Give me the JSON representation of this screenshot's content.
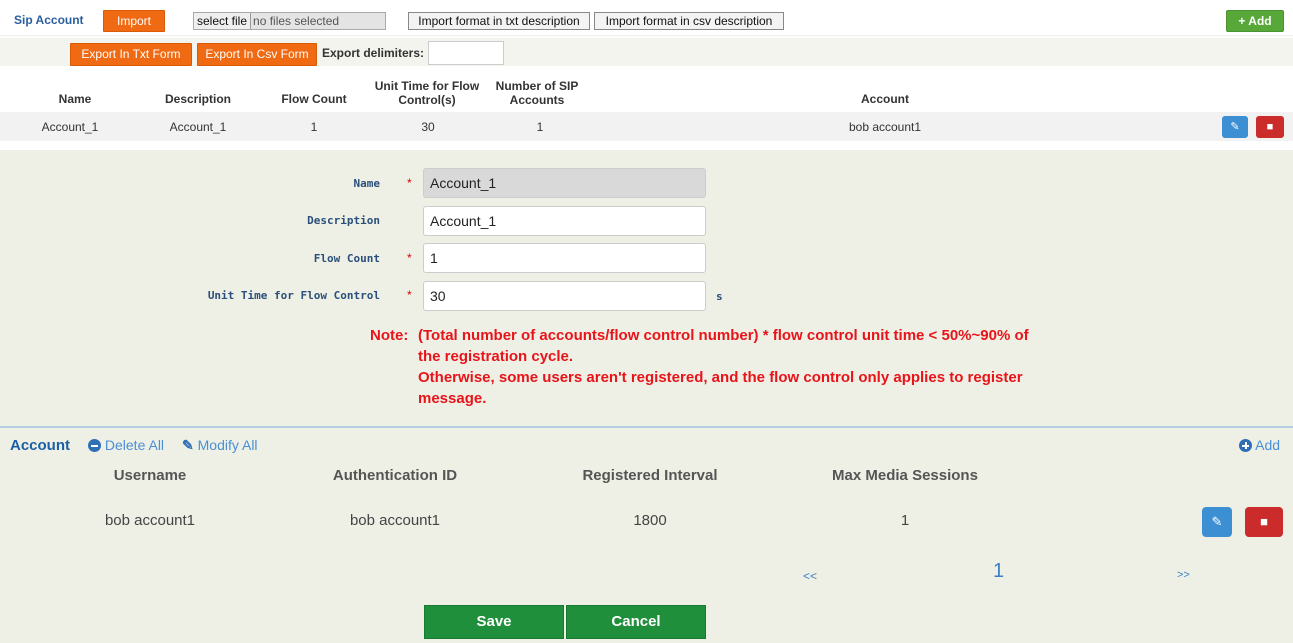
{
  "toolbar": {
    "title": "Sip Account",
    "import_label": "Import",
    "file_select_label": "select file",
    "file_status": "no files selected",
    "txt_desc_label": "Import format in txt description",
    "csv_desc_label": "Import format in csv description",
    "add_label": "+ Add",
    "export_txt_label": "Export In Txt Form",
    "export_csv_label": "Export In Csv Form",
    "delimiters_label": "Export delimiters:",
    "delimiters_value": ""
  },
  "sip_table": {
    "headers": [
      "Name",
      "Description",
      "Flow Count",
      "Unit Time for Flow Control(s)",
      "Number of SIP Accounts",
      "Account"
    ],
    "rows": [
      {
        "name": "Account_1",
        "description": "Account_1",
        "flow_count": "1",
        "unit_time": "30",
        "num_accounts": "1",
        "account": "bob account1"
      }
    ]
  },
  "form": {
    "name_label": "Name",
    "name_value": "Account_1",
    "description_label": "Description",
    "description_value": "Account_1",
    "flow_count_label": "Flow Count",
    "flow_count_value": "1",
    "unit_time_label": "Unit Time for Flow Control",
    "unit_time_value": "30",
    "unit_suffix": "s",
    "required_mark": "*",
    "note_prefix": "Note:",
    "note_lines": [
      "(Total number of accounts/flow control number) * flow control unit time < 50%~90% of",
      "the registration cycle.",
      "Otherwise, some users aren't registered, and the flow control only applies to register",
      "message."
    ]
  },
  "account_section": {
    "title": "Account",
    "delete_all_label": "Delete All",
    "modify_all_label": "Modify All",
    "add_label": "Add",
    "headers": [
      "Username",
      "Authentication ID",
      "Registered Interval",
      "Max Media Sessions"
    ],
    "rows": [
      {
        "username": "bob account1",
        "auth_id": "bob account1",
        "interval": "1800",
        "max_sessions": "1"
      }
    ],
    "pager": {
      "prev": "<<",
      "page": "1",
      "next": ">>"
    }
  },
  "actions": {
    "save_label": "Save",
    "cancel_label": "Cancel"
  },
  "colors": {
    "accent_orange": "#ef6a12",
    "add_green": "#57a839",
    "save_green": "#1f8f3c",
    "note_red": "#e8141a",
    "edit_blue": "#3d8fd3",
    "delete_red": "#cc2b2b"
  }
}
